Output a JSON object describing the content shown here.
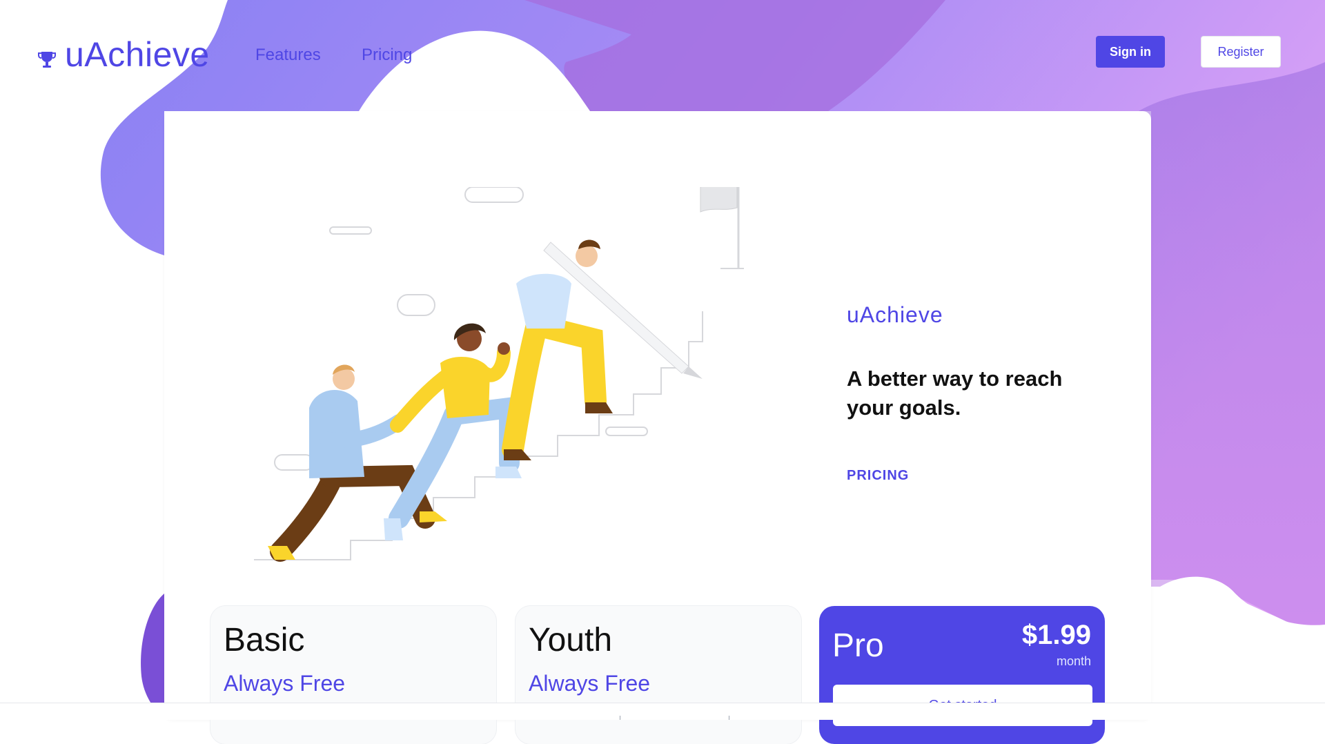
{
  "header": {
    "logo_text": "uAchieve",
    "nav": [
      "Features",
      "Pricing"
    ],
    "signin_label": "Sign in",
    "register_label": "Register"
  },
  "hero": {
    "brand": "uAchieve",
    "tagline": "A better way to reach your goals.",
    "pricing_link": "PRICING"
  },
  "plans": [
    {
      "name": "Basic",
      "price": "Always Free"
    },
    {
      "name": "Youth",
      "price": "Always Free"
    },
    {
      "name": "Pro",
      "amount": "$1.99",
      "period": "month",
      "cta": "Get started"
    }
  ],
  "colors": {
    "accent": "#4f46e5",
    "gradient_start": "#8b7cf6",
    "gradient_end": "#e0a6f7",
    "figure_yellow": "#fad42b",
    "figure_blue": "#a9cbf0",
    "figure_brown": "#6b3d15"
  },
  "icons": {
    "logo": "trophy-icon"
  }
}
